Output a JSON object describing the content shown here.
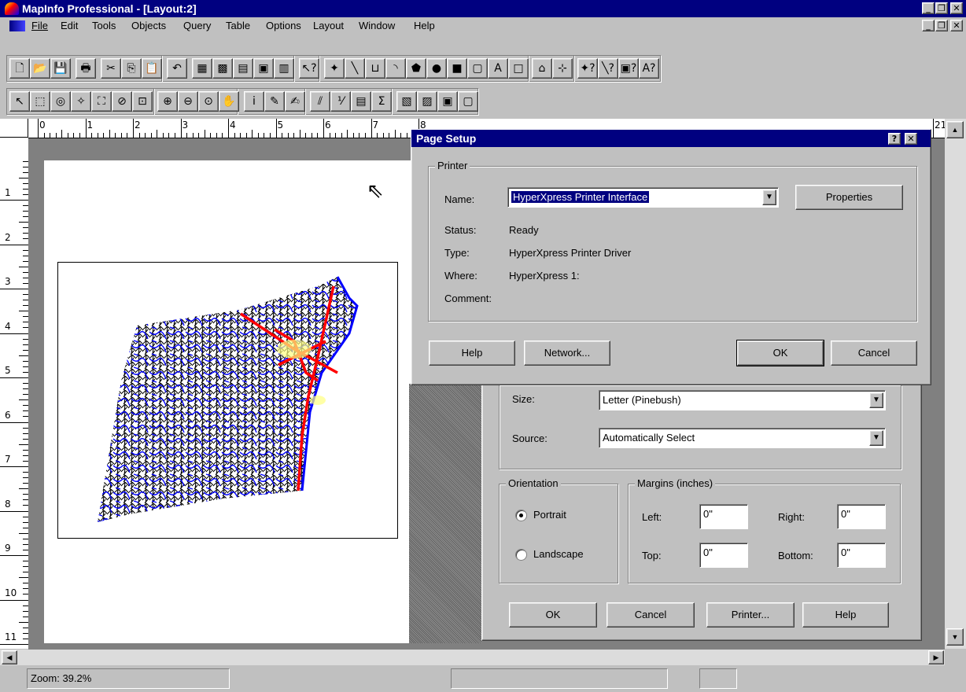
{
  "window": {
    "title": "MapInfo Professional - [Layout:2]"
  },
  "menu": [
    "File",
    "Edit",
    "Tools",
    "Objects",
    "Query",
    "Table",
    "Options",
    "Layout",
    "Window",
    "Help"
  ],
  "toolbar1": {
    "icons": [
      "new-icon",
      "open-icon",
      "save-icon",
      "print-icon",
      "cut-icon",
      "copy-icon",
      "paste-icon",
      "undo-icon",
      "browser-icon",
      "map-icon",
      "graph-icon",
      "layout-icon",
      "redistrict-icon",
      "help-pointer-icon",
      "symbol-tool-icon",
      "line-tool-icon",
      "polyline-tool-icon",
      "arc-tool-icon",
      "polygon-tool-icon",
      "ellipse-tool-icon",
      "rectangle-tool-icon",
      "rounded-rectangle-tool-icon",
      "text-tool-icon",
      "frame-tool-icon",
      "reshape-icon",
      "add-node-icon",
      "symbol-style-icon",
      "line-style-icon",
      "region-style-icon",
      "text-style-icon"
    ],
    "glyphs": [
      "🗋",
      "📂",
      "💾",
      "🖶",
      "✂",
      "⎘",
      "📋",
      "↶",
      "▦",
      "▩",
      "▤",
      "▣",
      "▥",
      "↖?",
      "✦",
      "╲",
      "⊔",
      "◝",
      "⬟",
      "●",
      "■",
      "▢",
      "A",
      "□",
      "⌂",
      "⊹",
      "✦?",
      "╲?",
      "▣?",
      "A?"
    ]
  },
  "toolbar2": {
    "icons": [
      "select-icon",
      "marquee-select-icon",
      "radius-select-icon",
      "polygon-select-icon",
      "boundary-select-icon",
      "unselect-all-icon",
      "graph-select-icon",
      "zoom-in-icon",
      "zoom-out-icon",
      "change-view-icon",
      "grabber-icon",
      "info-icon",
      "ruler-icon",
      "label-icon",
      "drag-map-icon",
      "legend-icon",
      "statistics-icon",
      "sum-icon",
      "thematic-icon",
      "cosmetic-icon",
      "layer-control-icon",
      "clip-region-icon"
    ],
    "glyphs": [
      "↖",
      "⬚",
      "◎",
      "✧",
      "⛶",
      "⊘",
      "⊡",
      "⊕",
      "⊖",
      "⊙",
      "✋",
      "i",
      "✎",
      "✍",
      "⫽",
      "⅟",
      "▤",
      "Σ",
      "▧",
      "▨",
      "▣",
      "▢"
    ]
  },
  "ruler": {
    "top": [
      "0",
      "1",
      "2",
      "3",
      "4",
      "5",
      "6",
      "7",
      "8",
      "21"
    ],
    "left": [
      "1",
      "2",
      "3",
      "4",
      "5",
      "6",
      "7",
      "8",
      "9",
      "10",
      "11"
    ]
  },
  "page_setup_back": {
    "size_label": "Size:",
    "size_value": "Letter (Pinebush)",
    "source_label": "Source:",
    "source_value": "Automatically Select",
    "orientation_title": "Orientation",
    "portrait": "Portrait",
    "landscape": "Landscape",
    "orientation_selected": "Portrait",
    "margins_title": "Margins (inches)",
    "left_label": "Left:",
    "left_value": "0\"",
    "right_label": "Right:",
    "right_value": "0\"",
    "top_label": "Top:",
    "top_value": "0\"",
    "bottom_label": "Bottom:",
    "bottom_value": "0\"",
    "ok": "OK",
    "cancel": "Cancel",
    "printer": "Printer...",
    "help": "Help"
  },
  "printer_dialog": {
    "title": "Page Setup",
    "group_title": "Printer",
    "name_label": "Name:",
    "name_value": "HyperXpress Printer Interface",
    "properties": "Properties",
    "status_label": "Status:",
    "status_value": "Ready",
    "type_label": "Type:",
    "type_value": "HyperXpress Printer Driver",
    "where_label": "Where:",
    "where_value": "HyperXpress 1:",
    "comment_label": "Comment:",
    "comment_value": "",
    "help": "Help",
    "network": "Network...",
    "ok": "OK",
    "cancel": "Cancel",
    "help_cap": "?",
    "close_cap": "✕"
  },
  "statusbar": {
    "zoom": "Zoom: 39.2%"
  },
  "colors": {
    "titlebar": "#000080",
    "face": "#c0c0c0",
    "map_roads": "#000000",
    "map_water": "#0000ff",
    "map_highways": "#ff0000",
    "map_urban": "#ffff80"
  }
}
